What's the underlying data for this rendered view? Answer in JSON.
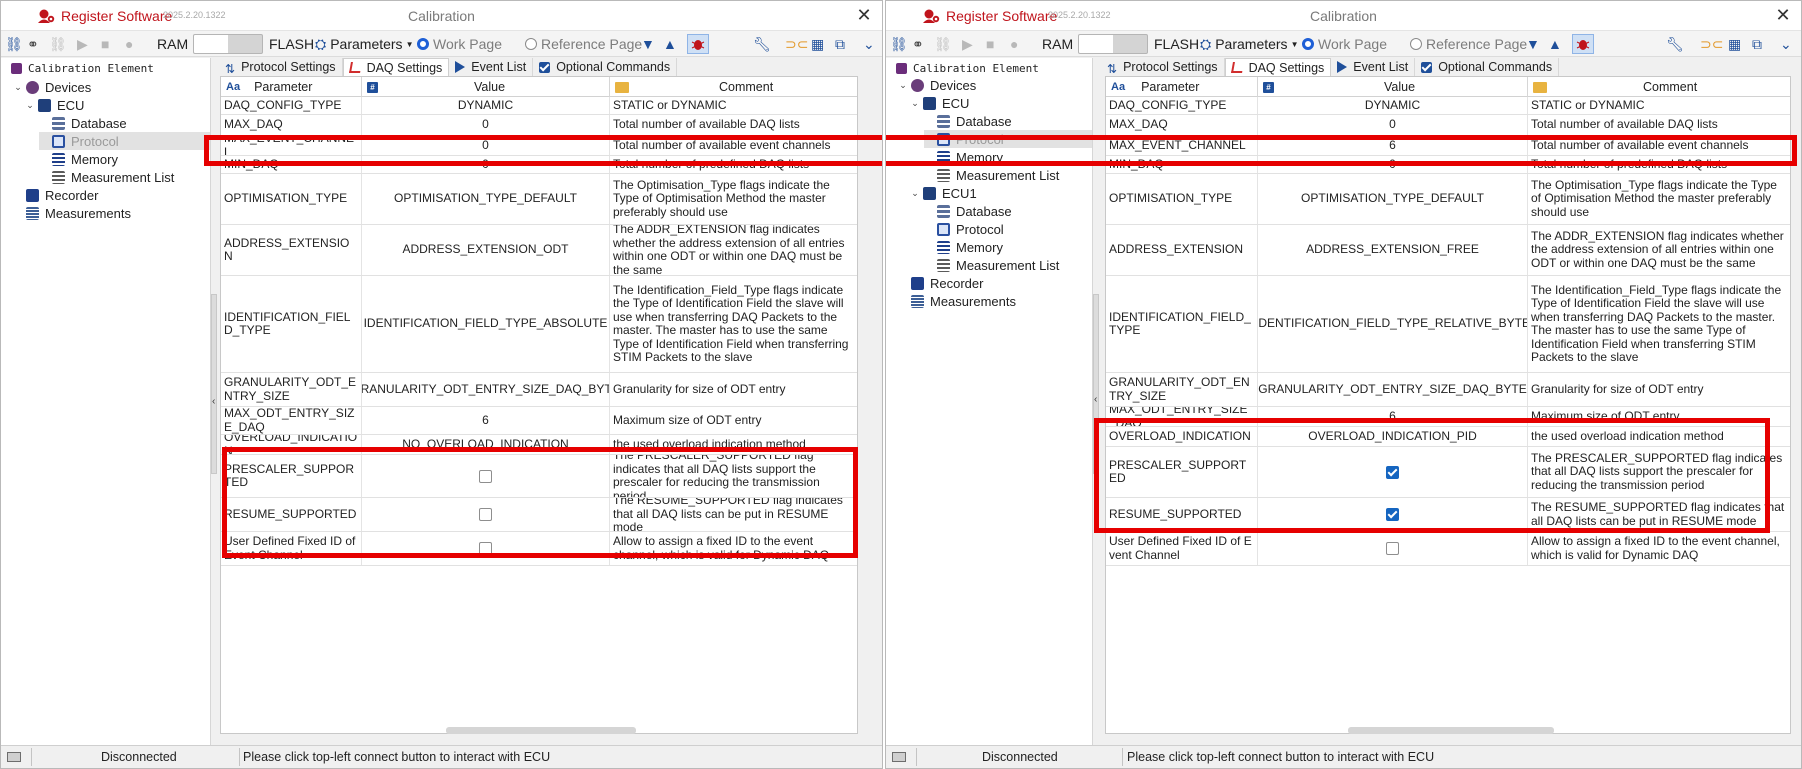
{
  "app": {
    "name": "Register Software",
    "version": "2025.2.20.1322",
    "window_title": "Calibration"
  },
  "toolbar": {
    "ram_label": "RAM",
    "flash_label": "FLASH",
    "parameters_label": "Parameters",
    "work_page_label": "Work Page",
    "reference_page_label": "Reference Page"
  },
  "tree": {
    "root_label": "Calibration Element"
  },
  "tabs": {
    "protocol_settings": "Protocol Settings",
    "daq_settings": "DAQ Settings",
    "event_list": "Event List",
    "optional_commands": "Optional Commands"
  },
  "columns": {
    "parameter": "Parameter",
    "value": "Value",
    "comment": "Comment"
  },
  "status": {
    "connection": "Disconnected",
    "message": "Please click top-left connect button to interact with ECU"
  },
  "left": {
    "tree_nodes": [
      {
        "label": "Devices",
        "level": 1,
        "icon": "devices-icon",
        "expanded": true
      },
      {
        "label": "ECU",
        "level": 2,
        "icon": "ecu-icon",
        "expanded": true
      },
      {
        "label": "Database",
        "level": 3,
        "icon": "database-icon"
      },
      {
        "label": "Protocol",
        "level": 3,
        "icon": "protocol-icon",
        "selected": true
      },
      {
        "label": "Memory",
        "level": 3,
        "icon": "memory-icon"
      },
      {
        "label": "Measurement List",
        "level": 3,
        "icon": "measurement-list-icon"
      },
      {
        "label": "Recorder",
        "level": 1,
        "icon": "recorder-icon"
      },
      {
        "label": "Measurements",
        "level": 1,
        "icon": "measurements-icon"
      }
    ],
    "rows": [
      {
        "param": "DAQ_CONFIG_TYPE",
        "value": "DYNAMIC",
        "comment": "STATIC or DYNAMIC"
      },
      {
        "param": "MAX_DAQ",
        "value": "0",
        "comment": "Total number of available DAQ lists"
      },
      {
        "param": "MAX_EVENT_CHANNEL",
        "value": "0",
        "comment": "Total number of available event channels"
      },
      {
        "param": "MIN_DAQ",
        "value": "0",
        "comment": "Total number of predefined DAQ lists"
      },
      {
        "param": "OPTIMISATION_TYPE",
        "value": "OPTIMISATION_TYPE_DEFAULT",
        "comment": "The Optimisation_Type flags indicate the Type of Optimisation Method the master preferably should use"
      },
      {
        "param": "ADDRESS_EXTENSION",
        "value": "ADDRESS_EXTENSION_ODT",
        "comment": "The ADDR_EXTENSION flag indicates whether the address extension of all entries within one ODT or within one DAQ must be the same"
      },
      {
        "param": "IDENTIFICATION_FIELD_TYPE",
        "value": "IDENTIFICATION_FIELD_TYPE_ABSOLUTE",
        "comment": "The Identification_Field_Type flags indicate the Type of Identification Field the slave will use when transferring DAQ Packets to the master. The master has to use the same Type of Identification Field when transferring STIM Packets to the slave"
      },
      {
        "param": "GRANULARITY_ODT_ENTRY_SIZE",
        "value": "GRANULARITY_ODT_ENTRY_SIZE_DAQ_BYTE",
        "comment": "Granularity for size of ODT entry"
      },
      {
        "param": "MAX_ODT_ENTRY_SIZE_DAQ",
        "value": "6",
        "comment": "Maximum size of ODT entry"
      },
      {
        "param": "OVERLOAD_INDICATION",
        "value": "NO_OVERLOAD_INDICATION",
        "comment": "the used overload indication method"
      },
      {
        "param": "PRESCALER_SUPPORTED",
        "checked": false,
        "comment": "The PRESCALER_SUPPORTED flag indicates that all DAQ lists support the prescaler for reducing the transmission period"
      },
      {
        "param": "RESUME_SUPPORTED",
        "checked": false,
        "comment": "The RESUME_SUPPORTED flag indicates that all DAQ lists can be put in RESUME mode"
      },
      {
        "param": "User Defined Fixed ID of Event Channel",
        "checked": false,
        "comment": "Allow to assign a fixed ID to the event channel, which is valid for Dynamic DAQ"
      }
    ]
  },
  "right": {
    "tree_nodes": [
      {
        "label": "Devices",
        "level": 1,
        "icon": "devices-icon",
        "expanded": true
      },
      {
        "label": "ECU",
        "level": 2,
        "icon": "ecu-icon",
        "expanded": true
      },
      {
        "label": "Database",
        "level": 3,
        "icon": "database-icon"
      },
      {
        "label": "Protocol",
        "level": 3,
        "icon": "protocol-icon",
        "selected": true
      },
      {
        "label": "Memory",
        "level": 3,
        "icon": "memory-icon"
      },
      {
        "label": "Measurement List",
        "level": 3,
        "icon": "measurement-list-icon"
      },
      {
        "label": "ECU1",
        "level": 2,
        "icon": "ecu-icon",
        "expanded": true
      },
      {
        "label": "Database",
        "level": 3,
        "icon": "database-icon"
      },
      {
        "label": "Protocol",
        "level": 3,
        "icon": "protocol-icon"
      },
      {
        "label": "Memory",
        "level": 3,
        "icon": "memory-icon"
      },
      {
        "label": "Measurement List",
        "level": 3,
        "icon": "measurement-list-icon"
      },
      {
        "label": "Recorder",
        "level": 1,
        "icon": "recorder-icon"
      },
      {
        "label": "Measurements",
        "level": 1,
        "icon": "measurements-icon"
      }
    ],
    "rows": [
      {
        "param": "DAQ_CONFIG_TYPE",
        "value": "DYNAMIC",
        "comment": "STATIC or DYNAMIC"
      },
      {
        "param": "MAX_DAQ",
        "value": "0",
        "comment": "Total number of available DAQ lists"
      },
      {
        "param": "MAX_EVENT_CHANNEL",
        "value": "6",
        "comment": "Total number of available event channels"
      },
      {
        "param": "MIN_DAQ",
        "value": "0",
        "comment": "Total number of predefined DAQ lists"
      },
      {
        "param": "OPTIMISATION_TYPE",
        "value": "OPTIMISATION_TYPE_DEFAULT",
        "comment": "The Optimisation_Type flags indicate the Type of Optimisation Method the master preferably should use"
      },
      {
        "param": "ADDRESS_EXTENSION",
        "value": "ADDRESS_EXTENSION_FREE",
        "comment": "The ADDR_EXTENSION flag indicates whether the address extension of all entries within one ODT or within one DAQ must be the same"
      },
      {
        "param": "IDENTIFICATION_FIELD_TYPE",
        "value": "IDENTIFICATION_FIELD_TYPE_RELATIVE_BYTE",
        "comment": "The Identification_Field_Type flags indicate the Type of Identification Field the slave will use when transferring DAQ Packets to the master. The master has to use the same Type of Identification Field when transferring STIM Packets to the slave"
      },
      {
        "param": "GRANULARITY_ODT_ENTRY_SIZE",
        "value": "GRANULARITY_ODT_ENTRY_SIZE_DAQ_BYTE",
        "comment": "Granularity for size of ODT entry"
      },
      {
        "param": "MAX_ODT_ENTRY_SIZE_DAQ",
        "value": "6",
        "comment": "Maximum size of ODT entry"
      },
      {
        "param": "OVERLOAD_INDICATION",
        "value": "OVERLOAD_INDICATION_PID",
        "comment": "the used overload indication method"
      },
      {
        "param": "PRESCALER_SUPPORTED",
        "checked": true,
        "comment": "The PRESCALER_SUPPORTED flag indicates that all DAQ lists support the prescaler for reducing the transmission period"
      },
      {
        "param": "RESUME_SUPPORTED",
        "checked": true,
        "comment": "The RESUME_SUPPORTED flag indicates that all DAQ lists can be put in RESUME mode"
      },
      {
        "param": "User Defined Fixed ID of Event Channel",
        "checked": false,
        "comment": "Allow to assign a fixed ID to the event channel, which is valid for Dynamic DAQ"
      }
    ]
  },
  "colors": {
    "brand_red": "#c0141c",
    "highlight_red": "#e60000",
    "accent_blue": "#1565c0"
  }
}
